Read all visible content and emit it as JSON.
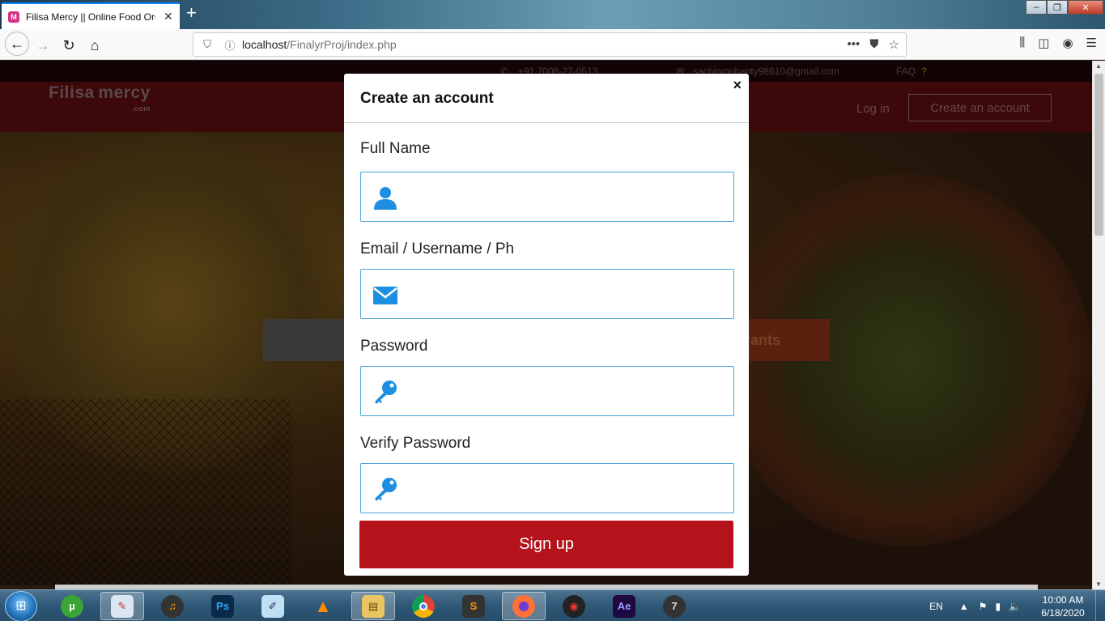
{
  "browser": {
    "tab_title": "Filisa Mercy || Online Food Ord",
    "tab_close": "✕",
    "new_tab": "+",
    "url_host": "localhost",
    "url_path": "/FinalyrProj/index.php",
    "url_more": "•••"
  },
  "site": {
    "logo_text": "Filisa mercy",
    "logo_suffix": ".com",
    "phone": "+91 7008-27-0513",
    "email": "sachinmohanty98610@gmail.com",
    "faq": "FAQ",
    "faq_mark": "?",
    "login": "Log in",
    "create_account": "Create an account",
    "search_button": "aurants"
  },
  "modal": {
    "title": "Create an account",
    "close": "×",
    "fields": [
      {
        "label": "Full Name",
        "icon": "user-icon",
        "value": ""
      },
      {
        "label": "Email / Username / Ph",
        "icon": "envelope-icon",
        "value": ""
      },
      {
        "label": "Password",
        "icon": "key-icon",
        "value": ""
      },
      {
        "label": "Verify Password",
        "icon": "key-icon",
        "value": ""
      }
    ],
    "submit": "Sign up"
  },
  "taskbar": {
    "language": "EN",
    "time": "10:00 AM",
    "date": "6/18/2020",
    "apps": [
      "utorrent",
      "paint",
      "fl-studio",
      "photoshop",
      "notepad",
      "vlc",
      "file-explorer",
      "chrome",
      "sublime-text",
      "firefox",
      "media-player",
      "after-effects",
      "windows-7-utility"
    ]
  },
  "colors": {
    "accent": "#b5121b",
    "icon_blue": "#1e8fe0",
    "field_border": "#4aa5d8"
  }
}
